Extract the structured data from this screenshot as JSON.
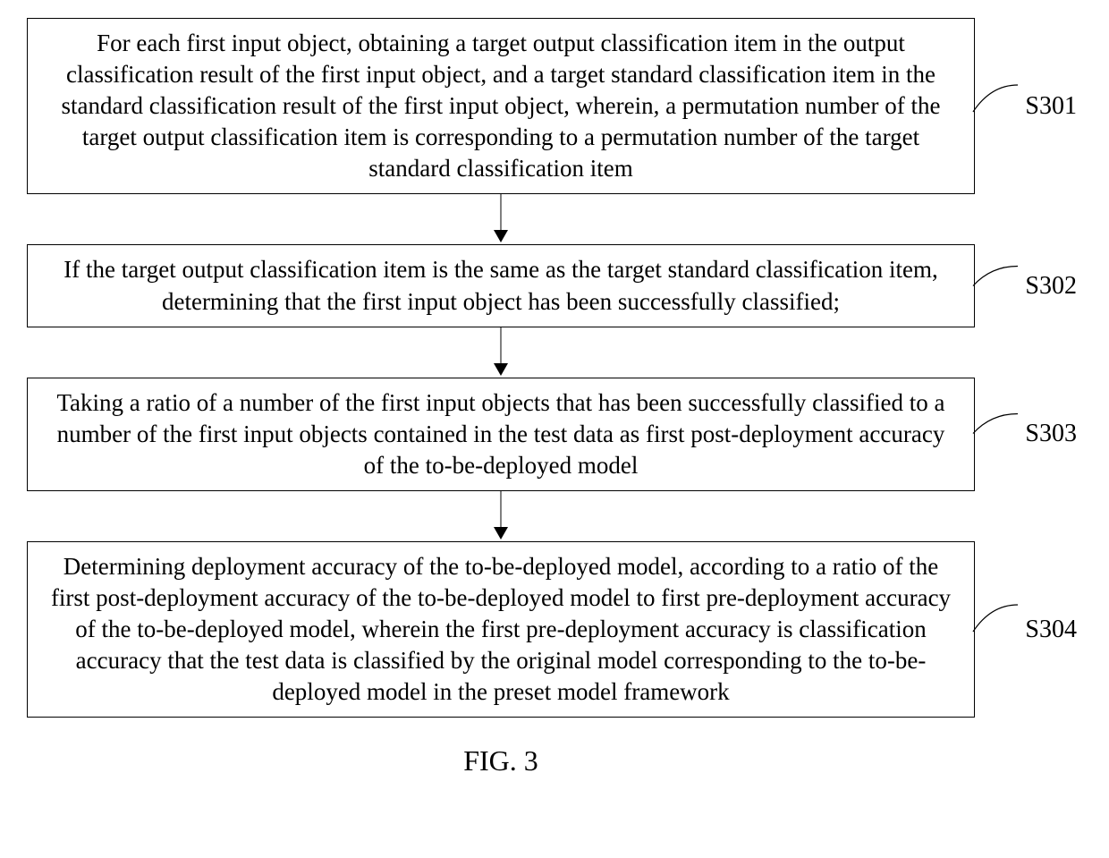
{
  "chart_data": {
    "type": "flowchart",
    "title": "FIG. 3",
    "steps": [
      {
        "id": "S301",
        "text": "For each first input object, obtaining a target output classification item in the output classification result of the first input object, and a target standard classification item in the standard classification result of the first input object, wherein, a permutation number of the target output classification item is corresponding to a permutation number of the target standard classification item"
      },
      {
        "id": "S302",
        "text": "If the target output classification item is the same as the target standard classification item, determining that the first input object has been successfully classified;"
      },
      {
        "id": "S303",
        "text": "Taking a ratio of a number of the first input objects that has been successfully classified to a number of the first input objects contained in the test data as first post-deployment accuracy of the to-be-deployed model"
      },
      {
        "id": "S304",
        "text": "Determining deployment accuracy of the to-be-deployed model, according to a ratio of the first post-deployment accuracy of the to-be-deployed model to first pre-deployment accuracy of the to-be-deployed model, wherein the first pre-deployment accuracy is classification accuracy that the test data is classified by the original model corresponding to the to-be-deployed model in the preset model framework"
      }
    ],
    "caption": "FIG. 3"
  }
}
